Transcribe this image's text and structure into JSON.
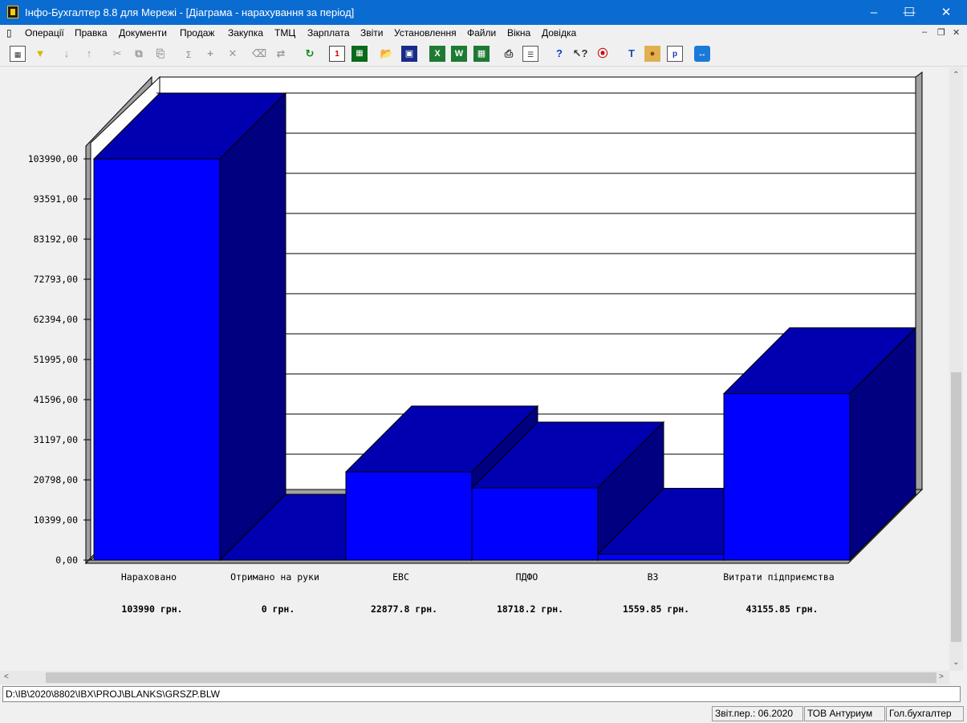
{
  "window": {
    "title": "Інфо-Бухгалтер 8.8 для Мережі - [Діаграма - нарахування за період]"
  },
  "menu": [
    "Операції",
    "Правка",
    "Документи",
    "Продаж",
    "Закупка",
    "ТМЦ",
    "Зарплата",
    "Звіти",
    "Установлення",
    "Файли",
    "Вікна",
    "Довідка"
  ],
  "toolbar_icons": [
    "grid-icon",
    "filter-icon",
    "sort-ascending-icon",
    "sort-descending-icon",
    "cut-icon",
    "copy-icon",
    "paste-icon",
    "sum-icon",
    "add-icon",
    "delete-icon",
    "clear-icon",
    "replace-icon",
    "refresh-icon",
    "document-icon",
    "calculator-icon",
    "open-folder-icon",
    "save-icon",
    "excel-icon",
    "word-icon",
    "spreadsheet-icon",
    "print-icon",
    "preview-icon",
    "help-icon",
    "context-help-icon",
    "navigate-icon",
    "text-icon",
    "users-icon",
    "report-icon",
    "teamviewer-icon"
  ],
  "chart_data": {
    "type": "bar",
    "categories": [
      "Нараховано",
      "Отримано на руки",
      "ЕВС",
      "ПДФО",
      "ВЗ",
      "Витрати підприємства"
    ],
    "values": [
      103990,
      0,
      22877.8,
      18718.2,
      1559.85,
      43155.85
    ],
    "value_labels": [
      "103990 грн.",
      "0 грн.",
      "22877.8 грн.",
      "18718.2 грн.",
      "1559.85 грн.",
      "43155.85 грн."
    ],
    "yticks": [
      "0,00",
      "10399,00",
      "20798,00",
      "31197,00",
      "41596,00",
      "51995,00",
      "62394,00",
      "72793,00",
      "83192,00",
      "93591,00",
      "103990,00"
    ],
    "ylim": [
      0,
      103990
    ],
    "grid": true,
    "colors": {
      "front": "#0000ff",
      "top": "#0000b0",
      "side": "#000080",
      "wall": "#ffffff",
      "frame": "#a0a0a0"
    }
  },
  "status": {
    "path": "D:\\IB\\2020\\8802\\IBX\\PROJ\\BLANKS\\GRSZP.BLW",
    "period": "Звіт.пер.: 06.2020",
    "company": "ТОВ Антуриум",
    "role": "Гол.бухгалтер"
  }
}
